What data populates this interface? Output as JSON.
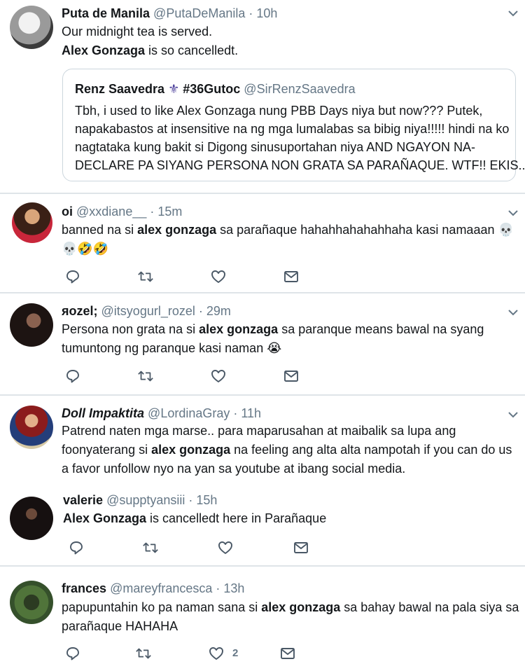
{
  "tweets": [
    {
      "name": "Puta de Manila",
      "handle": "@PutaDeManila · 10h",
      "line1": "Our midnight tea is served.",
      "line2_bold": "Alex Gonzaga",
      "line2_rest": " is so cancelledt.",
      "quote": {
        "name": "Renz Saavedra",
        "name_suffix": "#36Gutoc",
        "handle": "@SirRenzSaavedra",
        "lines": [
          "Tbh, i used to like Alex Gonzaga nung PBB Days niya but now??? Putek,",
          "napakabastos at insensitive na ng mga lumalabas sa bibig niya!!!!! hindi na ko",
          "nagtataka kung bakit si Digong sinusuportahan niya AND NGAYON NA-",
          "DECLARE PA SIYANG PERSONA NON GRATA SA PARAÑAQUE. WTF!! EKIS..."
        ]
      }
    },
    {
      "name": "oi",
      "handle": "@xxdiane__ · 15m",
      "l1_pre": "banned na si ",
      "l1_bold": "alex gonzaga",
      "l1_post": " sa parañaque hahahhahahahhaha kasi namaaan ",
      "l1_emoji": "💀",
      "l2_emoji": "💀🤣🤣"
    },
    {
      "name": "яozel;",
      "handle": "@itsyogurl_rozel · 29m",
      "l1_pre": "Persona non grata na si ",
      "l1_bold": "alex gonzaga",
      "l1_post": " sa paranque means bawal na syang",
      "l2": "tumuntong ng paranque kasi naman ",
      "l2_emoji": "😭"
    },
    {
      "name": "Doll Impaktita",
      "handle": "@LordinaGray · 11h",
      "l1": "Patrend naten mga marse.. para maparusahan at maibalik sa lupa ang",
      "l2_pre": "foonyaterang si ",
      "l2_bold": "alex gonzaga",
      "l2_post": " na feeling ang alta alta nampotah if you can do us",
      "l3": "a favor unfollow nyo na yan sa youtube at ibang social media."
    },
    {
      "name": "valerie",
      "handle": "@supptyansiii · 15h",
      "l1_bold": "Alex Gonzaga",
      "l1_post": " is cancelledt here in Parañaque"
    },
    {
      "name": "frances",
      "handle": "@mareyfrancesca · 13h",
      "l1_pre": "papupuntahin ko pa naman sana si ",
      "l1_bold": "alex gonzaga",
      "l1_post": " sa bahay bawal na pala siya sa",
      "l2": "parañaque HAHAHA",
      "likes": "2"
    }
  ]
}
